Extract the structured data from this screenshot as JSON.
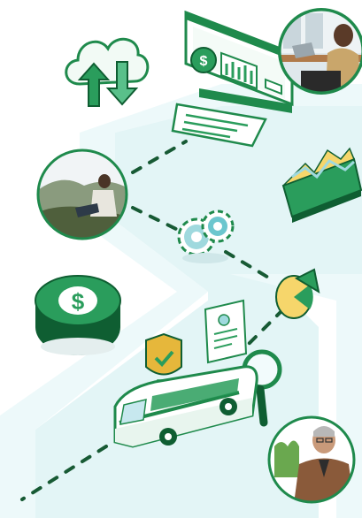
{
  "colors": {
    "primary_green": "#1f8a4c",
    "dark_green": "#0f5e32",
    "light_green": "#cfeedd",
    "road": "#e3f5f6",
    "road_edge": "#d3edef",
    "dash": "#175a34",
    "teal": "#9fd9de",
    "yellow": "#f6d66b",
    "gold": "#e6b73b"
  },
  "icons": {
    "cloud": "cloud-sync-icon",
    "payment_screen": "payment-terminal-icon",
    "mountain_chart": "mountain-chart-icon",
    "gears": "gears-icon",
    "pie_chart": "pie-chart-icon",
    "coin": "dollar-coin-icon",
    "shield": "shield-check-icon",
    "document": "profile-document-icon",
    "magnifier": "magnifier-icon",
    "bus": "bus-icon"
  }
}
